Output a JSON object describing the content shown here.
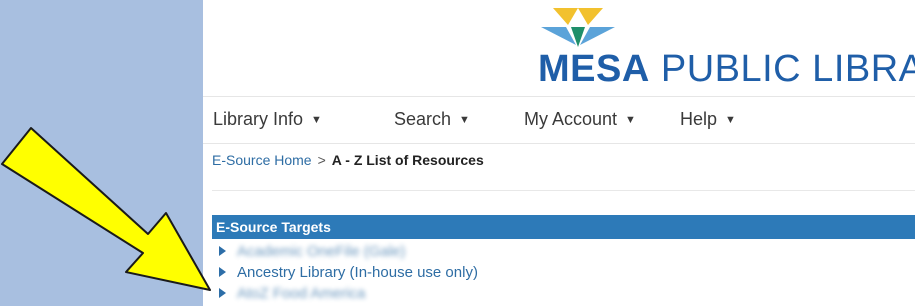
{
  "logo": {
    "bold_text": "MESA",
    "light_text": " PUBLIC LIBRARY",
    "colors": {
      "blue": "#1f5ea8",
      "yellow": "#f2c12e",
      "light_blue": "#5ba3d9"
    }
  },
  "nav": {
    "items": [
      {
        "label": "Library Info",
        "icon": "caret-down-icon"
      },
      {
        "label": "Search",
        "icon": "caret-down-icon"
      },
      {
        "label": "My Account",
        "icon": "caret-down-icon"
      },
      {
        "label": "Help",
        "icon": "caret-down-icon"
      }
    ]
  },
  "breadcrumb": {
    "home": "E-Source Home",
    "separator": ">",
    "current": "A - Z List of Resources"
  },
  "panel": {
    "title": "E-Source Targets",
    "header_color": "#2d7ab8",
    "items": [
      {
        "label": "Academic OneFile (Gale)",
        "blurred": true
      },
      {
        "label": "Ancestry Library (In-house use only)",
        "blurred": false
      },
      {
        "label": "AtoZ Food America",
        "blurred": true
      }
    ]
  },
  "callout": {
    "icon": "pointer-arrow-icon",
    "color": "#ffff00"
  }
}
